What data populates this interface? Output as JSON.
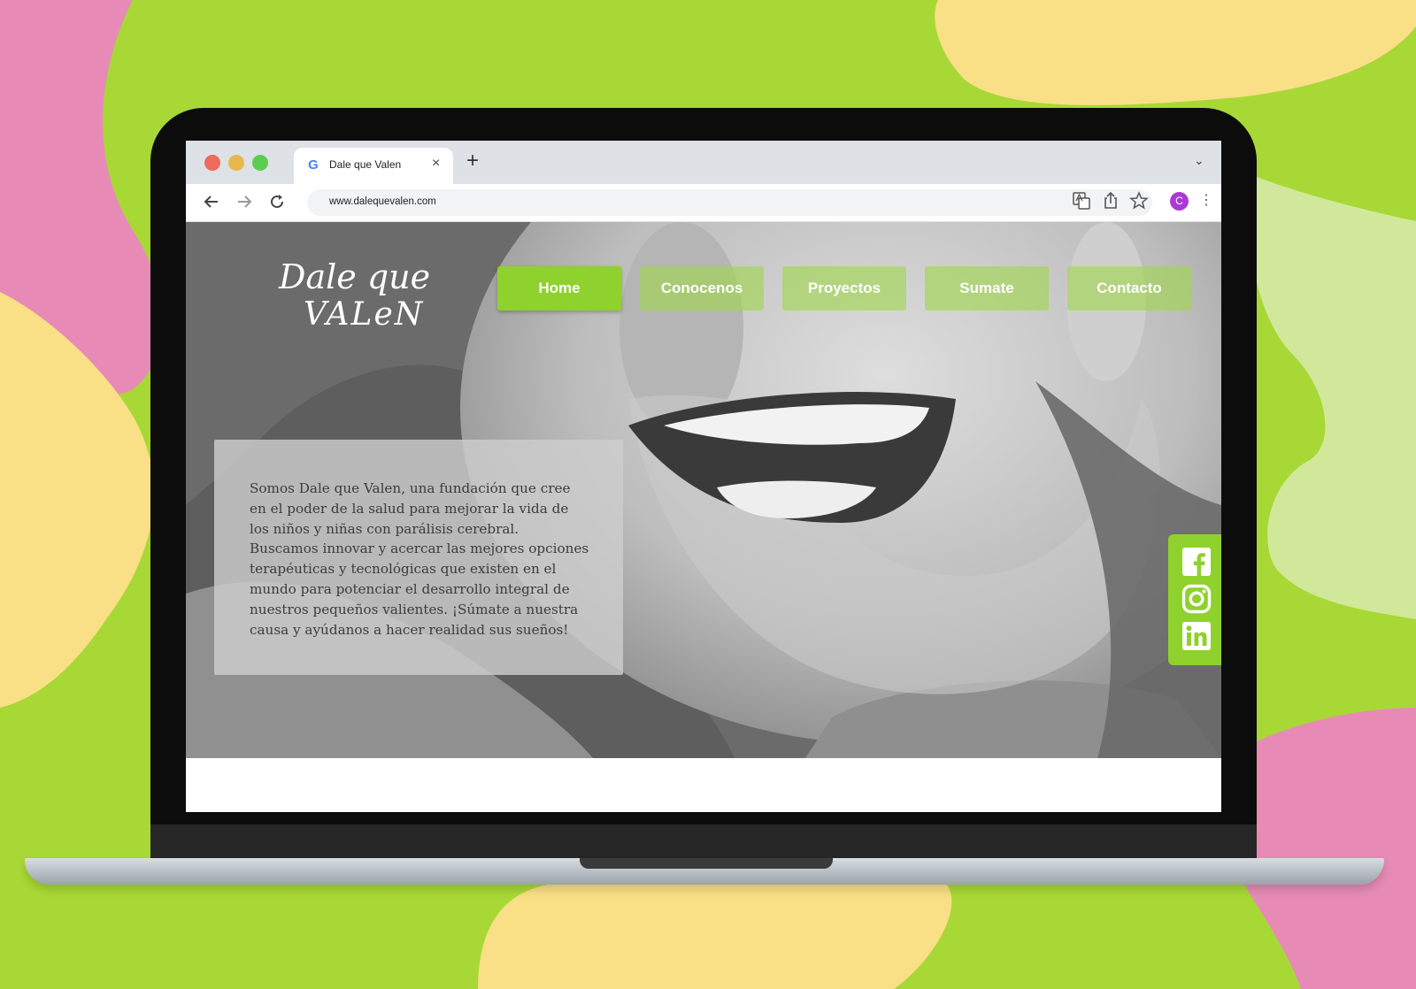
{
  "browser": {
    "tab_title": "Dale que Valen",
    "tab_favicon": "G",
    "tab_close": "×",
    "new_tab": "+",
    "tabs_menu": "⌄",
    "url": "www.dalequevalen.com",
    "profile_initial": "C",
    "menu": "⋮",
    "icons": [
      "back-arrow-icon",
      "forward-arrow-icon",
      "reload-icon",
      "translate-icon",
      "share-icon",
      "bookmark-star-icon"
    ]
  },
  "site": {
    "logo_line1": "Dale que",
    "logo_line2": "VALeN",
    "nav": {
      "home": "Home",
      "conocenos": "Conocenos",
      "proyectos": "Proyectos",
      "sumate": "Sumate",
      "contacto": "Contacto"
    },
    "intro": "Somos Dale que Valen, una fundación que cree en el poder de la salud para mejorar la vida de los niños y niñas con parálisis cerebral. Buscamos innovar y acercar las mejores opciones terapéuticas y tecnológicas que existen en el mundo para potenciar el desarrollo integral de nuestros pequeños valientes. ¡Súmate a nuestra causa y ayúdanos a hacer realidad sus sueños!",
    "social": [
      "facebook-icon",
      "instagram-icon",
      "linkedin-icon"
    ]
  },
  "colors": {
    "brand_green": "#8fd12d",
    "bg_green": "#a8d836",
    "bg_pink": "#e78bb6",
    "bg_yellow": "#f9df86",
    "bg_pale_green": "#d1e89a"
  }
}
